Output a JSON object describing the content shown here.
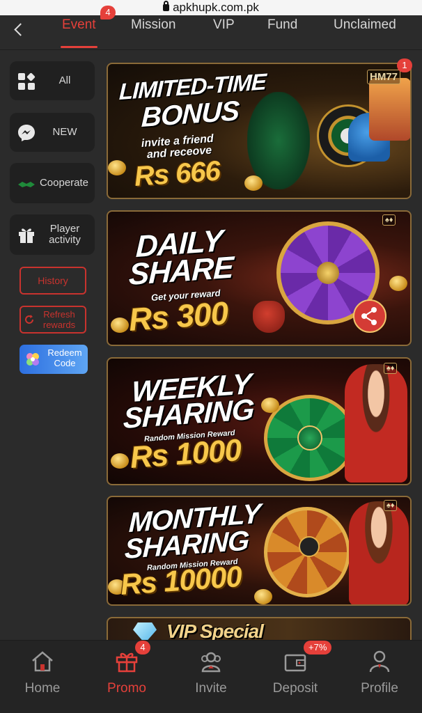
{
  "browser": {
    "url": "apkhupk.com.pk"
  },
  "colors": {
    "accent": "#e5403a",
    "background": "#2b2b2b",
    "gold": "#f7c74b"
  },
  "topnav": {
    "tabs": [
      {
        "label": "Event",
        "badge": "4",
        "active": true
      },
      {
        "label": "Mission"
      },
      {
        "label": "VIP"
      },
      {
        "label": "Fund"
      },
      {
        "label": "Unclaimed"
      }
    ]
  },
  "sidebar": {
    "items": [
      {
        "label": "All",
        "icon": "grid-icon"
      },
      {
        "label": "NEW",
        "icon": "messenger-icon"
      },
      {
        "label": "Cooperate",
        "icon": "handshake-icon"
      },
      {
        "label": "Player activity",
        "icon": "gift-icon"
      }
    ],
    "history_label": "History",
    "refresh_label": "Refresh rewards",
    "redeem_label": "Redeem Code"
  },
  "banners": [
    {
      "title_line1": "LIMITED-TIME",
      "title_line2": "BONUS",
      "sub_line1": "invite a friend",
      "sub_line2": "and receove",
      "amount": "Rs 666",
      "logo": "HM77",
      "badge": "1"
    },
    {
      "title_line1": "DAILY",
      "title_line2": "SHARE",
      "sub_line1": "Get your reward",
      "amount": "Rs 300"
    },
    {
      "title_line1": "WEEKLY",
      "title_line2": "SHARING",
      "sub_line1": "Random Mission Reward",
      "amount": "Rs 1000"
    },
    {
      "title_line1": "MONTHLY",
      "title_line2": "SHARING",
      "sub_line1": "Random Mission Reward",
      "amount": "Rs 10000"
    },
    {
      "title_line1": "VIP Special"
    }
  ],
  "bottomnav": {
    "items": [
      {
        "label": "Home",
        "icon": "home-icon"
      },
      {
        "label": "Promo",
        "icon": "gift-icon",
        "badge": "4",
        "active": true
      },
      {
        "label": "Invite",
        "icon": "invite-icon"
      },
      {
        "label": "Deposit",
        "icon": "wallet-icon",
        "badge": "+7%"
      },
      {
        "label": "Profile",
        "icon": "profile-icon"
      }
    ]
  }
}
